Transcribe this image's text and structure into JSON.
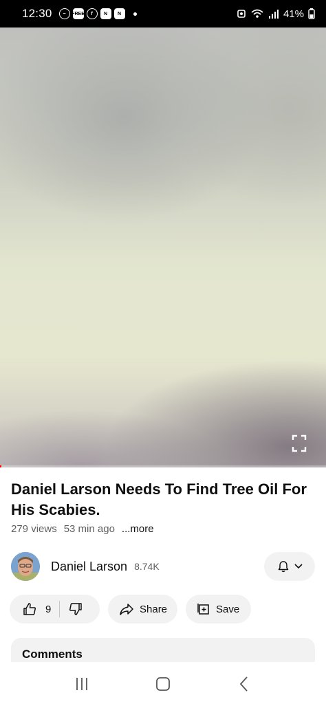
{
  "status_bar": {
    "time": "12:30",
    "battery": "41%",
    "icons": [
      "minus-circle-icon",
      "free-stuff-icon",
      "facebook-icon",
      "news-icon",
      "news-icon",
      "dot-icon",
      "alarm-icon",
      "wifi-icon",
      "signal-icon",
      "battery-icon"
    ]
  },
  "video": {
    "fullscreen_icon": "fullscreen-icon",
    "accent_color": "#ff0000"
  },
  "title": "Daniel Larson Needs To Find Tree Oil For His Scabies.",
  "meta": {
    "views": "279 views",
    "age": "53 min ago",
    "more": "...more"
  },
  "channel": {
    "name": "Daniel Larson",
    "subscribers": "8.74K",
    "bell_icon": "bell-icon",
    "chevron_icon": "chevron-down-icon"
  },
  "actions": {
    "likes": "9",
    "share": "Share",
    "save": "Save"
  },
  "comments": {
    "title": "Comments"
  },
  "nav": {
    "icons": [
      "recents-icon",
      "home-icon",
      "back-icon"
    ]
  }
}
